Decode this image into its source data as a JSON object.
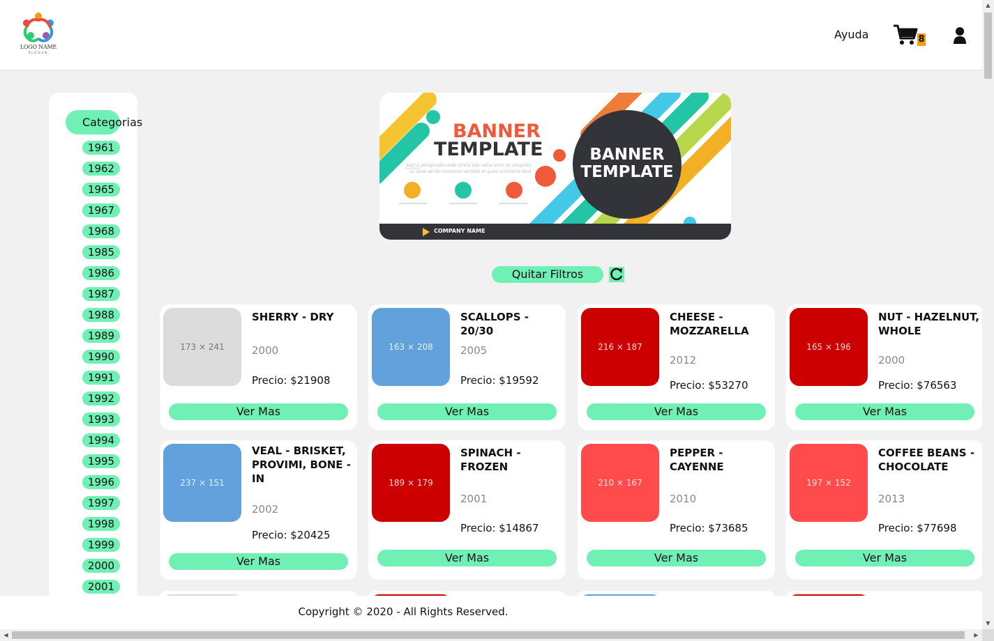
{
  "header": {
    "logo_name": "LOGO NAME",
    "logo_slogan": "SLOGAN",
    "help_label": "Ayuda",
    "cart_count": "8",
    "cart_icon": "cart-icon",
    "user_icon": "user-icon"
  },
  "sidebar": {
    "title": "Categorias",
    "years": [
      "1961",
      "1962",
      "1965",
      "1967",
      "1968",
      "1985",
      "1986",
      "1987",
      "1988",
      "1989",
      "1990",
      "1991",
      "1992",
      "1993",
      "1994",
      "1995",
      "1996",
      "1997",
      "1998",
      "1999",
      "2000",
      "2001"
    ]
  },
  "banner": {
    "heading_line1": "BANNER",
    "heading_line2": "TEMPLATE",
    "circle_line1": "BANNER",
    "circle_line2": "TEMPLATE",
    "body_text": "Sed ut perspiciatis unde omnis iste natus error sit voluptate su quae ab illo inventore veritatis et quasi architecto beat",
    "company": "COMPANY NAME"
  },
  "filters": {
    "clear_label": "Quitar Filtros",
    "refresh_icon": "refresh-icon"
  },
  "products": [
    {
      "name": "SHERRY - DRY",
      "year": "2000",
      "price": "Precio: $21908",
      "placeholder": "173 × 241",
      "color": "gray"
    },
    {
      "name": "SCALLOPS - 20/30",
      "year": "2005",
      "price": "Precio: $19592",
      "placeholder": "163 × 208",
      "color": "blue"
    },
    {
      "name": "CHEESE - MOZZARELLA",
      "year": "2012",
      "price": "Precio: $53270",
      "placeholder": "216 × 187",
      "color": "red"
    },
    {
      "name": "NUT - HAZELNUT, WHOLE",
      "year": "2000",
      "price": "Precio: $76563",
      "placeholder": "165 × 196",
      "color": "red"
    },
    {
      "name": "VEAL - BRISKET, PROVIMI, BONE - IN",
      "year": "2002",
      "price": "Precio: $20425",
      "placeholder": "237 × 151",
      "color": "blue"
    },
    {
      "name": "SPINACH - FROZEN",
      "year": "2001",
      "price": "Precio: $14867",
      "placeholder": "189 × 179",
      "color": "red"
    },
    {
      "name": "PEPPER - CAYENNE",
      "year": "2010",
      "price": "Precio: $73685",
      "placeholder": "210 × 167",
      "color": "pink"
    },
    {
      "name": "COFFEE BEANS - CHOCOLATE",
      "year": "2013",
      "price": "Precio: $77698",
      "placeholder": "197 × 152",
      "color": "pink"
    }
  ],
  "ver_mas_label": "Ver Mas",
  "footer": {
    "text": "Copyright © 2020 - All Rights Reserved."
  }
}
